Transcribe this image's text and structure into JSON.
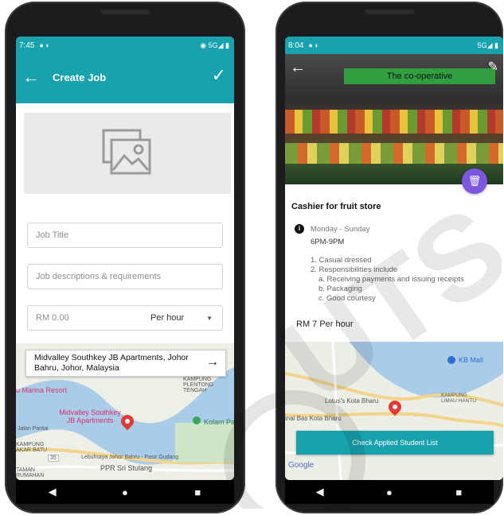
{
  "left": {
    "status": {
      "time": "7:45",
      "network": "5G"
    },
    "appbar": {
      "title": "Create Job"
    },
    "form": {
      "job_title_placeholder": "Job Title",
      "job_desc_placeholder": "Job descriptions & requirements",
      "rate_value": "RM 0.00",
      "rate_unit": "Per hour"
    },
    "map": {
      "address": "Midvalley Southkey JB Apartments, Johor Bahru, Johor, Malaysia",
      "labels": {
        "plentong": "KAMPUNG PLENTONG TENGAH",
        "marina": "u Marina Resort",
        "midvalley": "Midvalley Southkey JB Apartments",
        "kolam": "Kolam Pa",
        "kampung_akar": "KAMPUNG AKAR BATU",
        "lebuhraya": "Lebuhraya Johor Bahru - Pasir Gudang",
        "ppr": "PPR Sri Stulang",
        "taman": "TAMAN RUMAHAN",
        "jalan": "Jalan Pantai",
        "route": "35"
      }
    }
  },
  "right": {
    "status": {
      "time": "8:04",
      "network": "5G"
    },
    "header_image": {
      "store_sign": "The co-operative"
    },
    "job": {
      "title": "Cashier for fruit store",
      "days": "Monday - Sunday",
      "hours": "6PM-9PM",
      "requirements": [
        "1. Casual dressed",
        "2. Responsibilities include",
        "a. Receiving payments and issuing receipts",
        "b. Packaging",
        "c. Good courtesy"
      ],
      "pay": "RM 7 Per hour"
    },
    "map": {
      "labels": {
        "kb_mall": "KB Mall",
        "lotus": "Lotus's Kota Bharu",
        "kampung": "KAMPUNG LIMAU HANTU",
        "bas": "inal Bas Kota Bharu",
        "google": "Google"
      }
    },
    "button": {
      "label": "Check Applied Student List"
    }
  },
  "colors": {
    "primary": "#17a2ad",
    "fab": "#7b56e0",
    "pin": "#e53935"
  },
  "watermark": "UTS"
}
